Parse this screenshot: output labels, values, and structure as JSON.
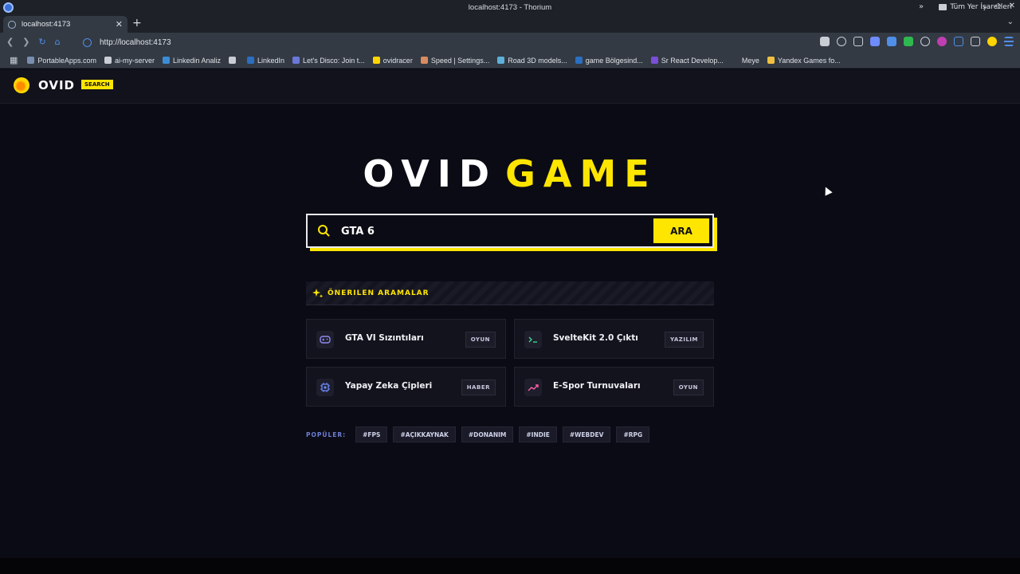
{
  "window": {
    "title": "localhost:4173 - Thorium"
  },
  "tabs": [
    {
      "title": "localhost:4173"
    }
  ],
  "address_bar": {
    "url": "http://localhost:4173"
  },
  "bookmarks": [
    {
      "label": "PortableApps.com",
      "color": "#7a8fb0"
    },
    {
      "label": "ai-my-server",
      "color": "#c9ced5"
    },
    {
      "label": "Linkedin Analiz",
      "color": "#3c8dd6"
    },
    {
      "label": "",
      "color": "#c9ced5"
    },
    {
      "label": "LinkedIn",
      "color": "#2a6fc0"
    },
    {
      "label": "Let's Disco: Join t...",
      "color": "#6a78d8"
    },
    {
      "label": "ovidracer",
      "color": "#ffd400"
    },
    {
      "label": "Speed | Settings...",
      "color": "#d98c5f"
    },
    {
      "label": "Road 3D models...",
      "color": "#5fb0d9"
    },
    {
      "label": "game Bölgesind...",
      "color": "#2a6fc0"
    },
    {
      "label": "Sr React Develop...",
      "color": "#7a4fd8"
    },
    {
      "label": "Meye",
      "color": "#333a44"
    },
    {
      "label": "Yandex Games fo...",
      "color": "#f0c040"
    }
  ],
  "bookmarks_all": "Tüm Yer İşaretleri",
  "site": {
    "logo_text": "OVID",
    "logo_badge": "SEARCH",
    "hero_word1": "OVID",
    "hero_word2": "GAME",
    "accent": "#ffe600",
    "search": {
      "value": "GTA 6",
      "button_label": "ARA"
    },
    "suggestions_title": "ÖNERILEN ARAMALAR",
    "suggestions": [
      {
        "title": "GTA VI Sızıntıları",
        "tag": "OYUN",
        "icon": "gamepad-icon",
        "icon_color": "#8f8cf0"
      },
      {
        "title": "SvelteKit 2.0 Çıktı",
        "tag": "YAZILIM",
        "icon": "terminal-icon",
        "icon_color": "#3fd68f"
      },
      {
        "title": "Yapay Zeka Çipleri",
        "tag": "HABER",
        "icon": "chip-icon",
        "icon_color": "#6f8cff"
      },
      {
        "title": "E-Spor Turnuvaları",
        "tag": "OYUN",
        "icon": "trending-icon",
        "icon_color": "#ff5fa8"
      }
    ],
    "popular_label": "POPÜLER:",
    "popular_tags": [
      "#FPS",
      "#AÇIKKAYNAK",
      "#DONANIM",
      "#INDIE",
      "#WEBDEV",
      "#RPG"
    ]
  }
}
